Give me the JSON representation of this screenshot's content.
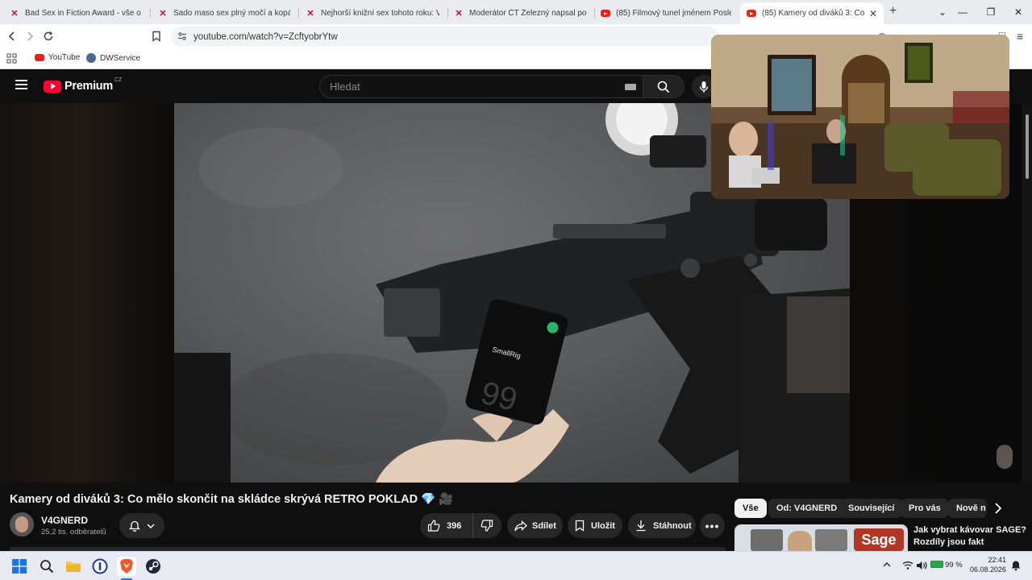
{
  "browser": {
    "tabs": [
      {
        "title": "Bad Sex in Fiction Award - vše o tém",
        "favicon": "x-icon"
      },
      {
        "title": "Sado maso sex plný močí a kopání d",
        "favicon": "x-icon"
      },
      {
        "title": "Nejhorší knižní sex tohoto roku: Vyh",
        "favicon": "x-icon"
      },
      {
        "title": "Moderátor ČT Železný napsal podiv",
        "favicon": "x-icon"
      },
      {
        "title": "(85) Filmový tunel jménem Posledn",
        "favicon": "youtube-icon"
      },
      {
        "title": "(85) Kamery od diváků 3: Co mě",
        "favicon": "youtube-icon",
        "active": true
      }
    ],
    "new_tab": "+",
    "url": "youtube.com/watch?v=ZcftyobrYtw",
    "bookmarks": [
      {
        "label": "YouTube",
        "icon": "youtube-icon"
      },
      {
        "label": "DWService",
        "icon": "dwservice-icon"
      }
    ]
  },
  "youtube": {
    "logo_text": "Premium",
    "region": "CZ",
    "search_placeholder": "Hledat",
    "video": {
      "title": "Kamery od diváků 3: Co mělo skončit na skládce skrývá RETRO POKLAD 💎 🎥",
      "device_brand": "SmallRig",
      "device_number": "99"
    },
    "channel": {
      "name": "V4GNERD",
      "subscribers": "25,2 tis. odběratelů"
    },
    "actions": {
      "likes": "396",
      "share": "Sdílet",
      "save": "Uložit",
      "download": "Stáhnout"
    },
    "chips": [
      "Vše",
      "Od: V4GNERD",
      "Související",
      "Pro vás",
      "Nově n"
    ],
    "recommendation": {
      "title_line1": "Jak vybrat kávovar SAGE?",
      "title_line2": "Rozdíly jsou fakt",
      "thumb_text": "Sage"
    }
  },
  "taskbar": {
    "battery": "99 %",
    "time": "22:41",
    "date": "06.08.2026"
  }
}
